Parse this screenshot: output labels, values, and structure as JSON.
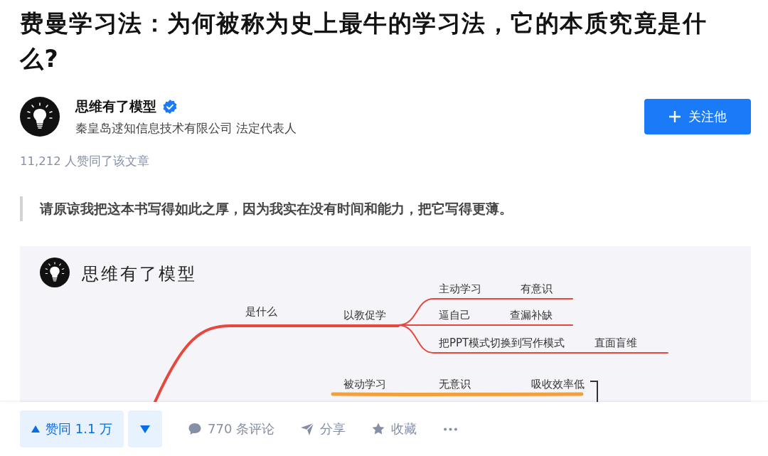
{
  "article": {
    "title": "费曼学习法：为何被称为史上最牛的学习法，它的本质究竟是什么?"
  },
  "author": {
    "name": "思维有了模型",
    "verified": true,
    "bio": "秦皇岛逑知信息技术有限公司 法定代表人"
  },
  "follow_button": {
    "label": "关注他"
  },
  "likes_summary": "11,212 人赞同了该文章",
  "quote": "请原谅我把这本书写得如此之厚，因为我实在没有时间和能力，把它写得更薄。",
  "figure": {
    "brand": "思维有了模型",
    "branches": [
      {
        "label": "是什么",
        "color": "#e8473f",
        "children": [
          {
            "label": "以教促学",
            "children": [
              {
                "label": "主动学习",
                "children": [
                  {
                    "label": "有意识"
                  }
                ]
              },
              {
                "label": "逼自己",
                "children": [
                  {
                    "label": "查漏补缺"
                  }
                ]
              },
              {
                "label": "把PPT模式切换到写作模式",
                "children": [
                  {
                    "label": "直面盲维"
                  }
                ]
              }
            ]
          }
        ]
      },
      {
        "color": "#f0a03c",
        "children": [
          {
            "label": "被动学习",
            "children": [
              {
                "label": "无意识",
                "children": [
                  {
                    "label": "吸收效率低"
                  }
                ]
              }
            ]
          }
        ]
      }
    ]
  },
  "action_bar": {
    "upvote": {
      "label": "赞同 1.1 万"
    },
    "actions": [
      {
        "kind": "comment",
        "label": "770 条评论"
      },
      {
        "kind": "share",
        "label": "分享"
      },
      {
        "kind": "favorite",
        "label": "收藏"
      },
      {
        "kind": "more"
      }
    ]
  }
}
